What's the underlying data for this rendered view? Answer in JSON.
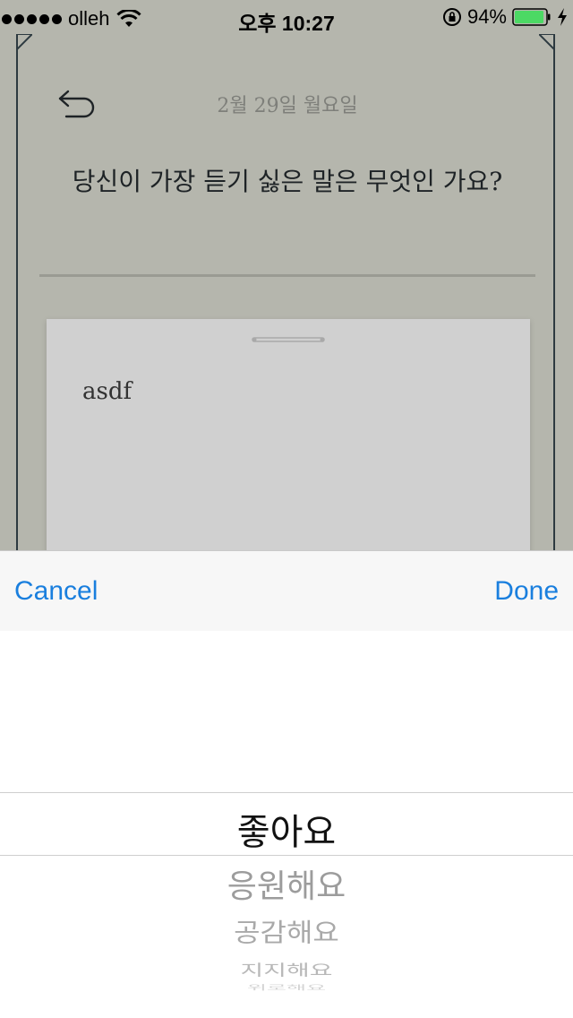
{
  "status_bar": {
    "carrier": "olleh",
    "time": "오후 10:27",
    "battery_percent": "94%",
    "battery_level": 0.94,
    "battery_color": "#4cd964",
    "signal_bars": 5
  },
  "entry": {
    "date": "2월 29일 월요일",
    "question": "당신이 가장 듣기 싫은 말은 무엇인 가요?",
    "answer": "asdf"
  },
  "toolbar": {
    "cancel_label": "Cancel",
    "done_label": "Done",
    "accent_color": "#1a7fde"
  },
  "picker": {
    "selected": "좋아요",
    "options": [
      "좋아요",
      "응원해요",
      "공감해요",
      "지지해요",
      "위로해요"
    ]
  },
  "icons": {
    "back": "undo-arrow-icon",
    "wifi": "wifi-icon",
    "rotation_lock": "rotation-lock-icon",
    "battery": "battery-icon",
    "charging": "bolt-icon"
  }
}
